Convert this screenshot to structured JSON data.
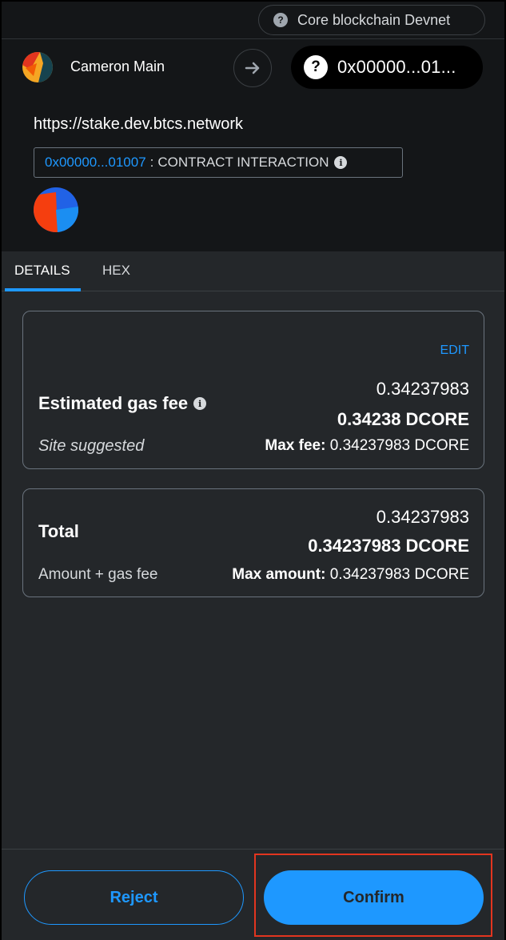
{
  "network": {
    "name": "Core blockchain Devnet",
    "icon": "question-icon"
  },
  "account": {
    "name": "Cameron Main",
    "avatar": "account-jazzicon"
  },
  "recipient": {
    "address": "0x00000...01...",
    "icon": "question-icon"
  },
  "origin": {
    "url": "https://stake.dev.btcs.network",
    "contract_address": "0x00000...01007",
    "separator": ":",
    "method_label": "CONTRACT INTERACTION",
    "info_icon": "i"
  },
  "tabs": [
    {
      "label": "DETAILS",
      "active": true
    },
    {
      "label": "HEX",
      "active": false
    }
  ],
  "gas": {
    "edit_label": "EDIT",
    "label": "Estimated gas fee",
    "info_icon": "i",
    "secondary_value": "0.34237983",
    "primary_value": "0.34238 DCORE",
    "source_label": "Site suggested",
    "max_fee_label": "Max fee:",
    "max_fee_value": "0.34237983 DCORE"
  },
  "total": {
    "label": "Total",
    "secondary_value": "0.34237983",
    "primary_value": "0.34237983 DCORE",
    "sub_label": "Amount + gas fee",
    "max_amount_label": "Max amount:",
    "max_amount_value": "0.34237983 DCORE"
  },
  "footer": {
    "reject_label": "Reject",
    "confirm_label": "Confirm"
  },
  "colors": {
    "accent": "#1e98ff",
    "background": "#24272a",
    "header_bg": "#141618",
    "highlight": "#e2351f"
  }
}
